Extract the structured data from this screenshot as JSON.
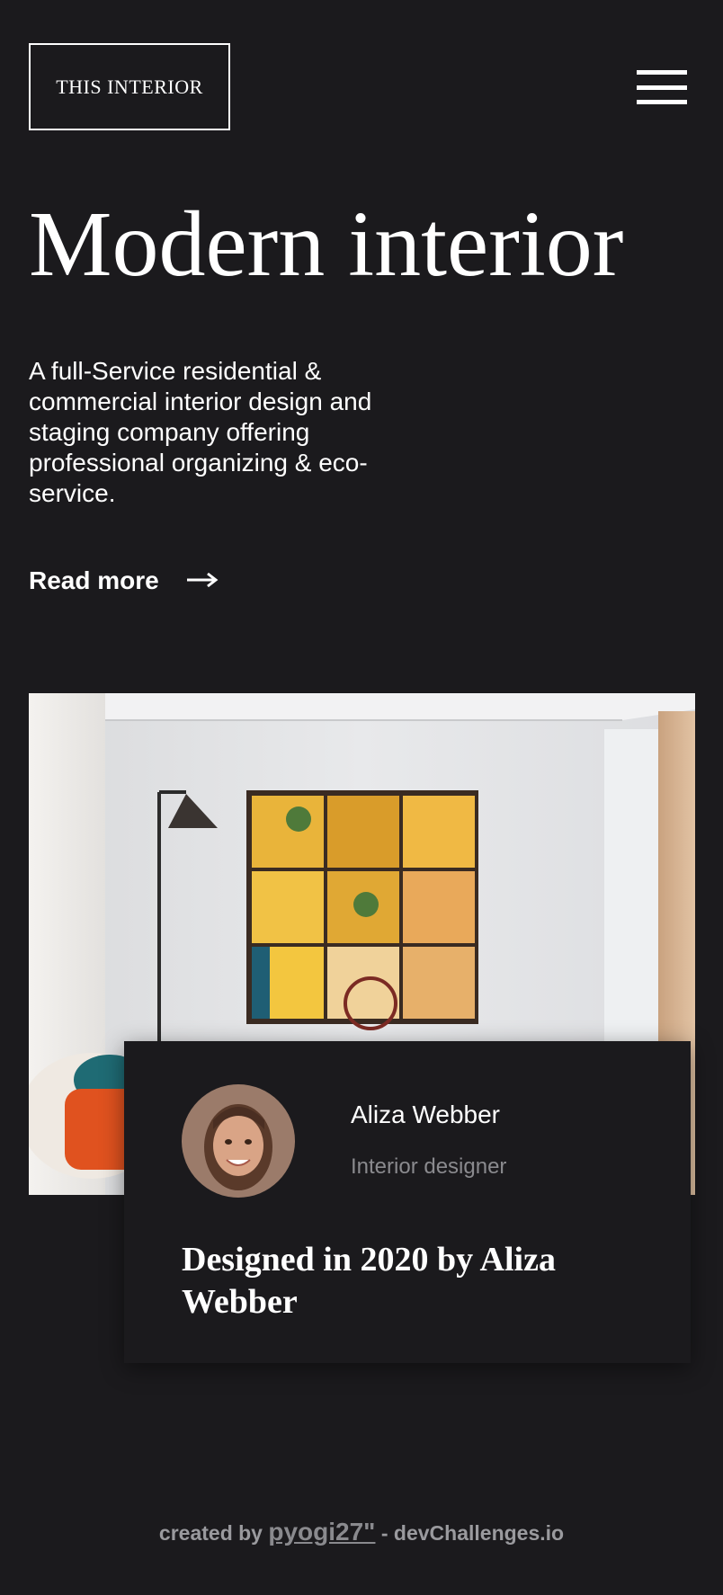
{
  "header": {
    "logo_text": "THIS INTERIOR",
    "menu_icon": "hamburger-icon"
  },
  "hero": {
    "title": "Modern interior",
    "description": "A full-Service residential & commercial interior design and staging company offering professional organizing & eco-service.",
    "read_more_label": "Read more",
    "arrow_glyph": "⟶",
    "arrow_icon": "arrow-right-icon"
  },
  "card": {
    "author_name": "Aliza Webber",
    "author_role": "Interior designer",
    "title": "Designed in 2020 by Aliza Webber"
  },
  "footer": {
    "prefix": "created by",
    "username": "pyogi27\"",
    "suffix": "- devChallenges.io"
  },
  "colors": {
    "background": "#1b1a1d",
    "text": "#ffffff",
    "muted": "#8a8a8e"
  }
}
